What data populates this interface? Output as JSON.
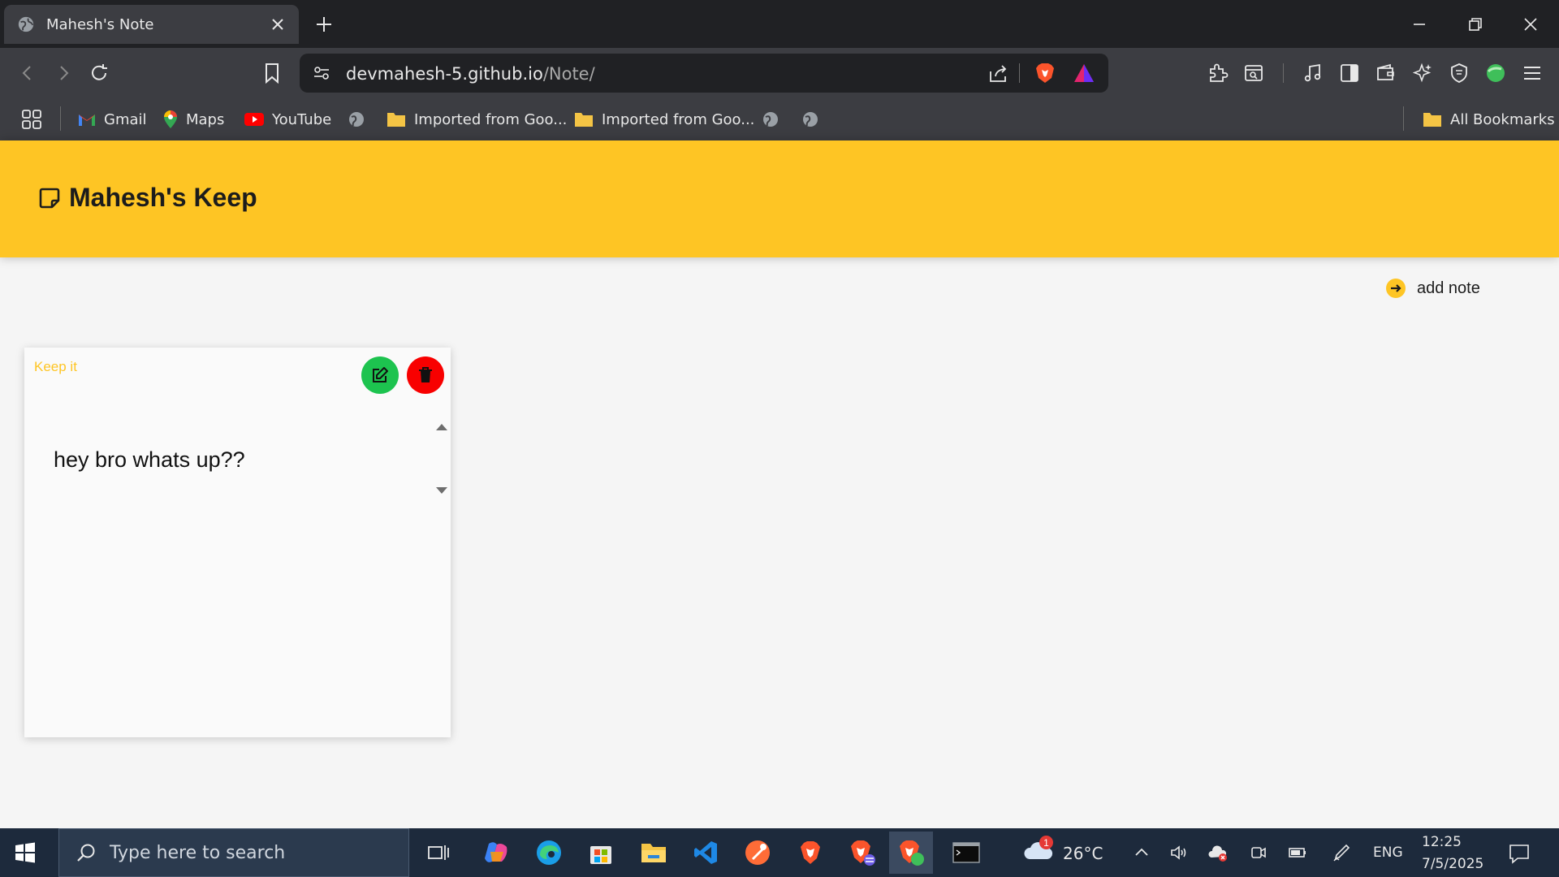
{
  "browser": {
    "tab_title": "Mahesh's Note",
    "url_host": "devmahesh-5.github.io",
    "url_path": "/Note/",
    "bookmarks": [
      {
        "label": "Gmail",
        "icon": "gmail-icon"
      },
      {
        "label": "Maps",
        "icon": "maps-icon"
      },
      {
        "label": "YouTube",
        "icon": "youtube-icon"
      },
      {
        "label": "Imported from Goo...",
        "icon": "folder-icon"
      },
      {
        "label": "Imported from Goo...",
        "icon": "folder-icon"
      }
    ],
    "all_bookmarks": "All Bookmarks"
  },
  "app": {
    "title": "Mahesh's Keep",
    "add_note": "add note",
    "accent": "#fec524",
    "notes": [
      {
        "label": "Keep it",
        "content": "hey bro whats up??"
      }
    ]
  },
  "taskbar": {
    "search_placeholder": "Type here to search",
    "weather": "26°C",
    "weather_badge": "1",
    "language": "ENG",
    "time": "12:25",
    "date": "7/5/2025"
  }
}
